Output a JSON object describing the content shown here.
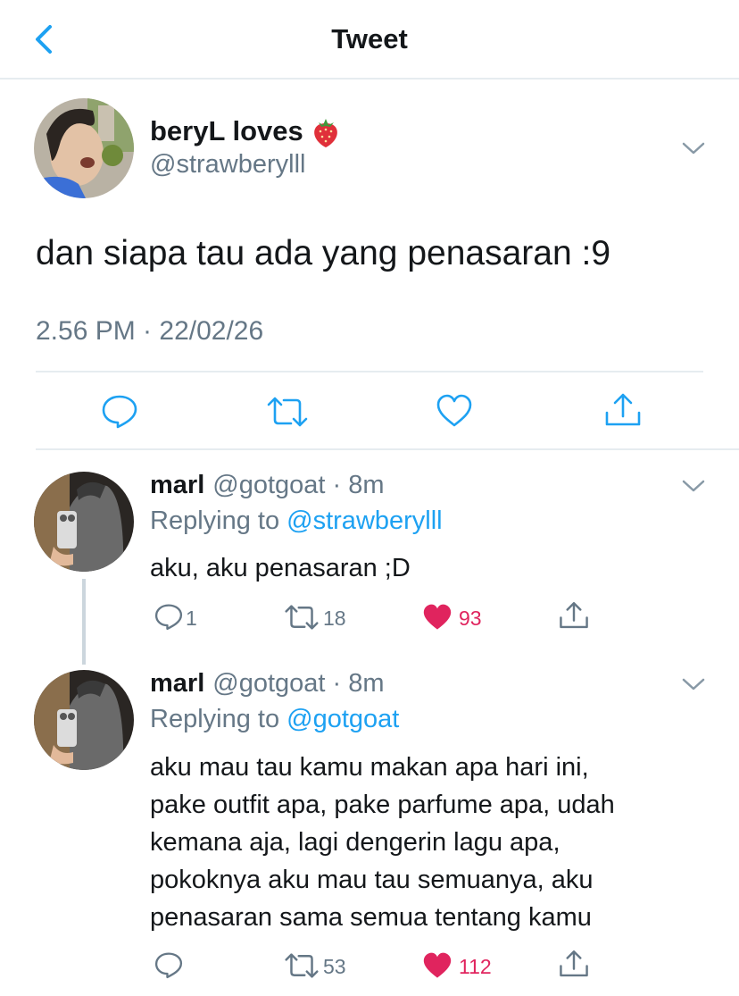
{
  "header": {
    "title": "Tweet"
  },
  "main_tweet": {
    "display_name": "beryL loves",
    "name_emoji": "strawberry",
    "handle": "@strawberylll",
    "text": "dan siapa tau ada yang penasaran :9",
    "timestamp": "2.56 PM · 22/02/26",
    "actions": [
      "reply-icon",
      "retweet-icon",
      "like-icon",
      "share-icon"
    ]
  },
  "replies": [
    {
      "display_name": "marl",
      "handle_time": "@gotgoat · 8m",
      "replying_label": "Replying to",
      "replying_to": "@strawberylll",
      "lines": [
        "aku, aku penasaran ;D"
      ],
      "reply_count": "1",
      "retweet_count": "18",
      "like_count": "93",
      "liked": true
    },
    {
      "display_name": "marl",
      "handle_time": "@gotgoat · 8m",
      "replying_label": "Replying to",
      "replying_to": "@gotgoat",
      "lines": [
        "aku mau tau kamu makan apa hari ini,",
        "pake outfit apa, pake parfume apa, udah",
        "kemana aja, lagi dengerin lagu apa,",
        "pokoknya aku mau tau semuanya, aku",
        "penasaran sama semua tentang kamu"
      ],
      "reply_count": "",
      "retweet_count": "53",
      "like_count": "112",
      "liked": true
    }
  ],
  "colors": {
    "accent": "#1da1f2",
    "secondary_text": "#657786",
    "like": "#e0245e",
    "divider": "#e6ecf0"
  }
}
